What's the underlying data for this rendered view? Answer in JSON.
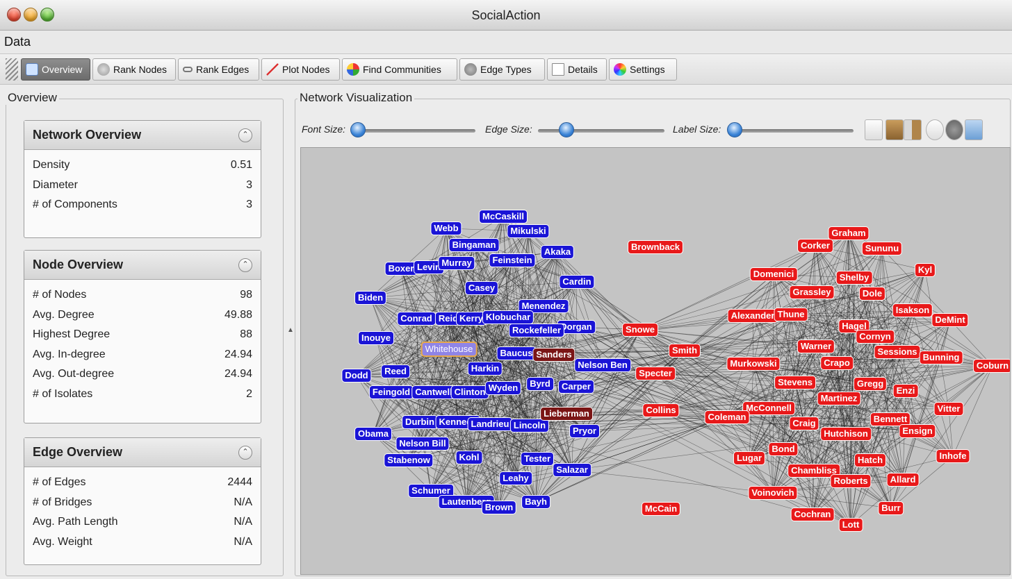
{
  "window": {
    "title": "SocialAction"
  },
  "menu": {
    "data": "Data"
  },
  "toolbar": {
    "overview": "Overview",
    "rank_nodes": "Rank Nodes",
    "rank_edges": "Rank Edges",
    "plot_nodes": "Plot Nodes",
    "find_communities": "Find Communities",
    "edge_types": "Edge Types",
    "details": "Details",
    "settings": "Settings"
  },
  "overview": {
    "group_title": "Overview",
    "network": {
      "title": "Network Overview",
      "rows": [
        {
          "label": "Density",
          "value": "0.51"
        },
        {
          "label": "Diameter",
          "value": "3"
        },
        {
          "label": "# of Components",
          "value": "3"
        }
      ]
    },
    "node": {
      "title": "Node Overview",
      "rows": [
        {
          "label": "# of Nodes",
          "value": "98"
        },
        {
          "label": "Avg. Degree",
          "value": "49.88"
        },
        {
          "label": "Highest Degree",
          "value": "88"
        },
        {
          "label": "Avg. In-degree",
          "value": "24.94"
        },
        {
          "label": "Avg. Out-degree",
          "value": "24.94"
        },
        {
          "label": "# of Isolates",
          "value": "2"
        }
      ]
    },
    "edge": {
      "title": "Edge Overview",
      "rows": [
        {
          "label": "# of Edges",
          "value": "2444"
        },
        {
          "label": "# of Bridges",
          "value": "N/A"
        },
        {
          "label": "Avg. Path Length",
          "value": "N/A"
        },
        {
          "label": "Avg. Weight",
          "value": "N/A"
        }
      ]
    }
  },
  "viz": {
    "group_title": "Network Visualization",
    "font_size_label": "Font Size:",
    "edge_size_label": "Edge Size:",
    "label_size_label": "Label Size:",
    "font_size_level": 0.0,
    "edge_size_level": 0.2,
    "label_size_level": 0.0,
    "colors": {
      "democrat": "#1a14d6",
      "republican": "#e8191a",
      "independent": "#7a1515",
      "selected": "#8f84e6",
      "background": "#c4c4c4"
    }
  },
  "nodes": {
    "dem": [
      "McCaskill",
      "Webb",
      "Mikulski",
      "Bingaman",
      "Akaka",
      "Boxer",
      "Levin",
      "Murray",
      "Feinstein",
      "Cardin",
      "Casey",
      "Biden",
      "Menendez",
      "Conrad",
      "Reid",
      "Kerry",
      "Klobuchar",
      "Dorgan",
      "Rockefeller",
      "Inouye",
      "Baucus",
      "Harkin",
      "Nelson Ben",
      "Dodd",
      "Reed",
      "Feingold",
      "Cantwell",
      "Clinton",
      "Wyden",
      "Byrd",
      "Carper",
      "Durbin",
      "Kennedy",
      "Landrieu",
      "Lincoln",
      "Obama",
      "Pryor",
      "Nelson Bill",
      "Stabenow",
      "Kohl",
      "Tester",
      "Salazar",
      "Leahy",
      "Schumer",
      "Lautenberg",
      "Brown",
      "Bayh"
    ],
    "selected": [
      "Whitehouse"
    ],
    "ind": [
      "Sanders",
      "Lieberman"
    ],
    "rep": [
      "Brownback",
      "Graham",
      "Corker",
      "Sununu",
      "Kyl",
      "Domenici",
      "Shelby",
      "Grassley",
      "Dole",
      "Alexander",
      "Thune",
      "Isakson",
      "DeMint",
      "Snowe",
      "Hagel",
      "Cornyn",
      "Smith",
      "Warner",
      "Sessions",
      "Bunning",
      "Coburn",
      "Murkowski",
      "Crapo",
      "Specter",
      "Stevens",
      "Gregg",
      "Enzi",
      "Martinez",
      "Collins",
      "McConnell",
      "Coleman",
      "Vitter",
      "Craig",
      "Bennett",
      "Hutchison",
      "Ensign",
      "Bond",
      "Lugar",
      "Hatch",
      "Inhofe",
      "Chambliss",
      "Roberts",
      "Allard",
      "Voinovich",
      "Burr",
      "Cochran",
      "Lott",
      "McCain"
    ]
  }
}
